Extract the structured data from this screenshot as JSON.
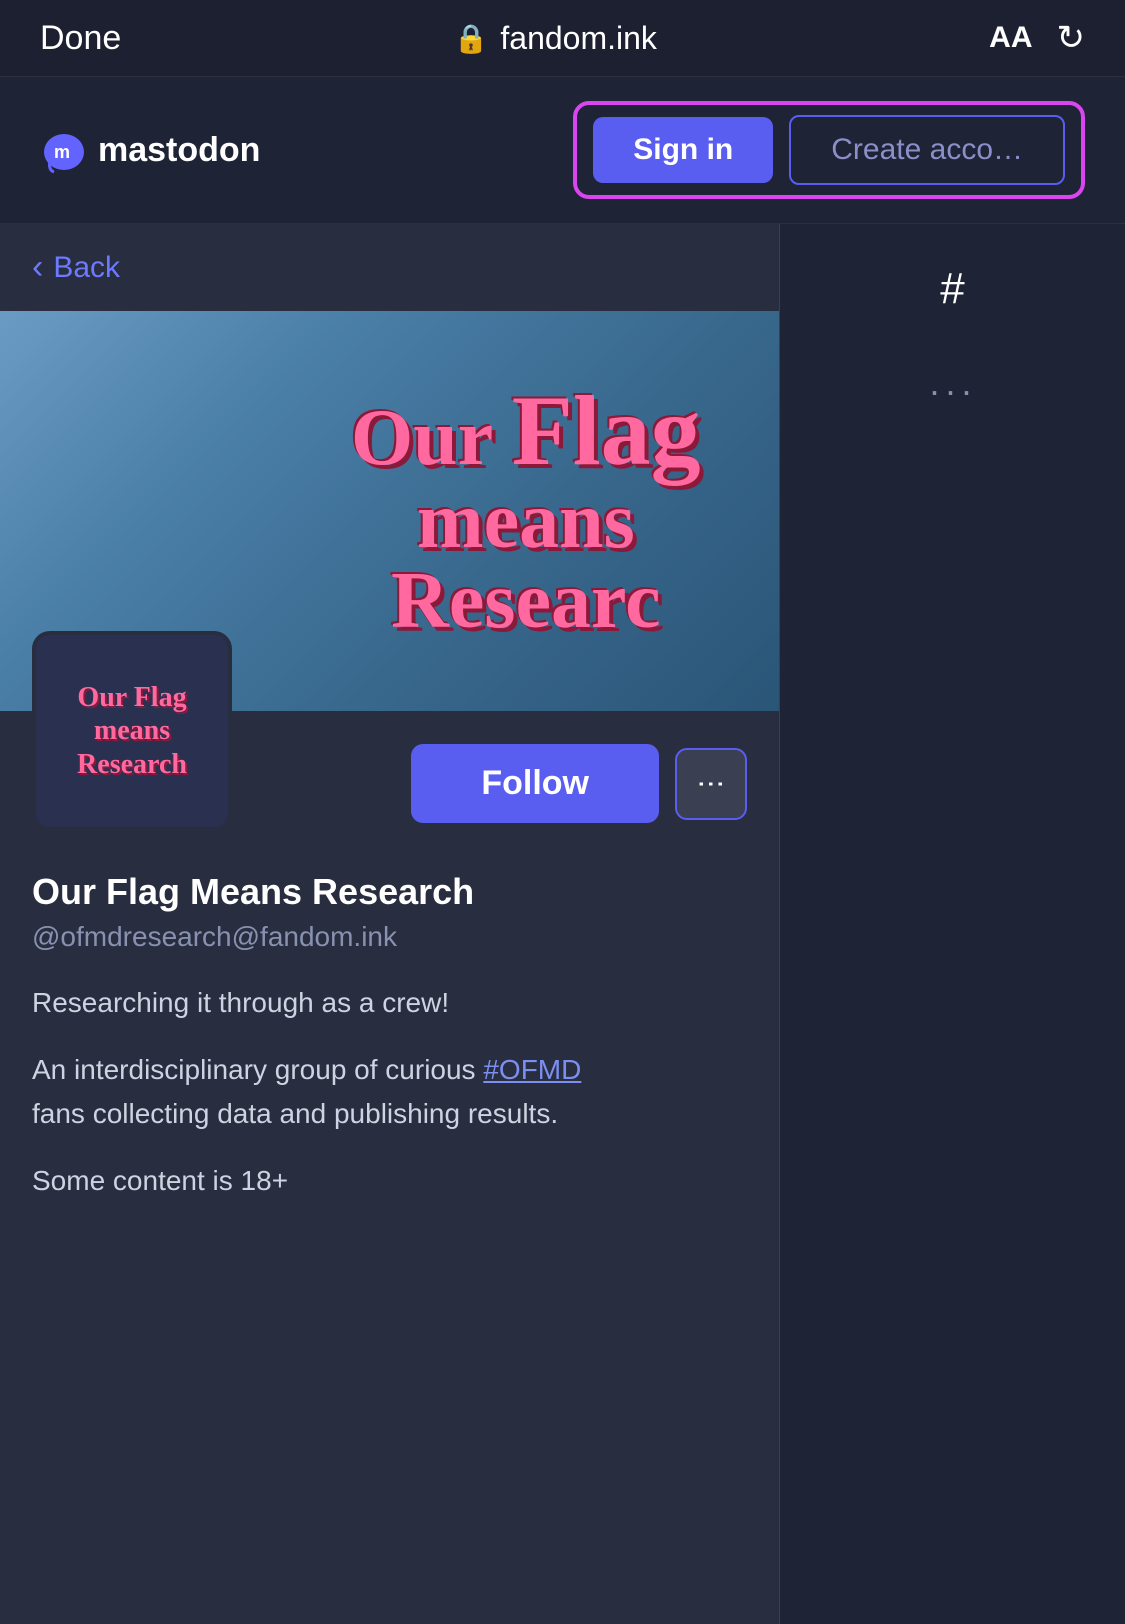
{
  "browser": {
    "done_label": "Done",
    "url": "fandom.ink",
    "aa_label": "AA",
    "lock_icon": "🔒"
  },
  "mastodon_nav": {
    "logo_text": "mastodon",
    "signin_label": "Sign in",
    "create_label": "Create acco…"
  },
  "profile_topbar": {
    "back_label": "Back",
    "hashtag_label": "#"
  },
  "profile_banner": {
    "title_line1": "Our Flag",
    "title_line2": "means",
    "title_line3": "Researc"
  },
  "avatar": {
    "text": "Our Flag\nmeans\nResearch"
  },
  "profile_actions": {
    "follow_label": "Follow",
    "more_dots": "⋮"
  },
  "profile_info": {
    "name": "Our Flag Means Research",
    "handle": "@ofmdresearch@fandom.ink",
    "bio_line1": "Researching it through as a crew!",
    "bio_line2_prefix": "An interdisciplinary group of curious ",
    "bio_link": "#OFMD",
    "bio_line2_suffix": "\nfans collecting data and publishing results.",
    "bio_line3": "Some content is 18+"
  },
  "colors": {
    "accent_purple": "#5a5ef0",
    "accent_pink": "#d946ef",
    "handle_gray": "#8892b0",
    "banner_text_pink": "#ff69a0"
  }
}
